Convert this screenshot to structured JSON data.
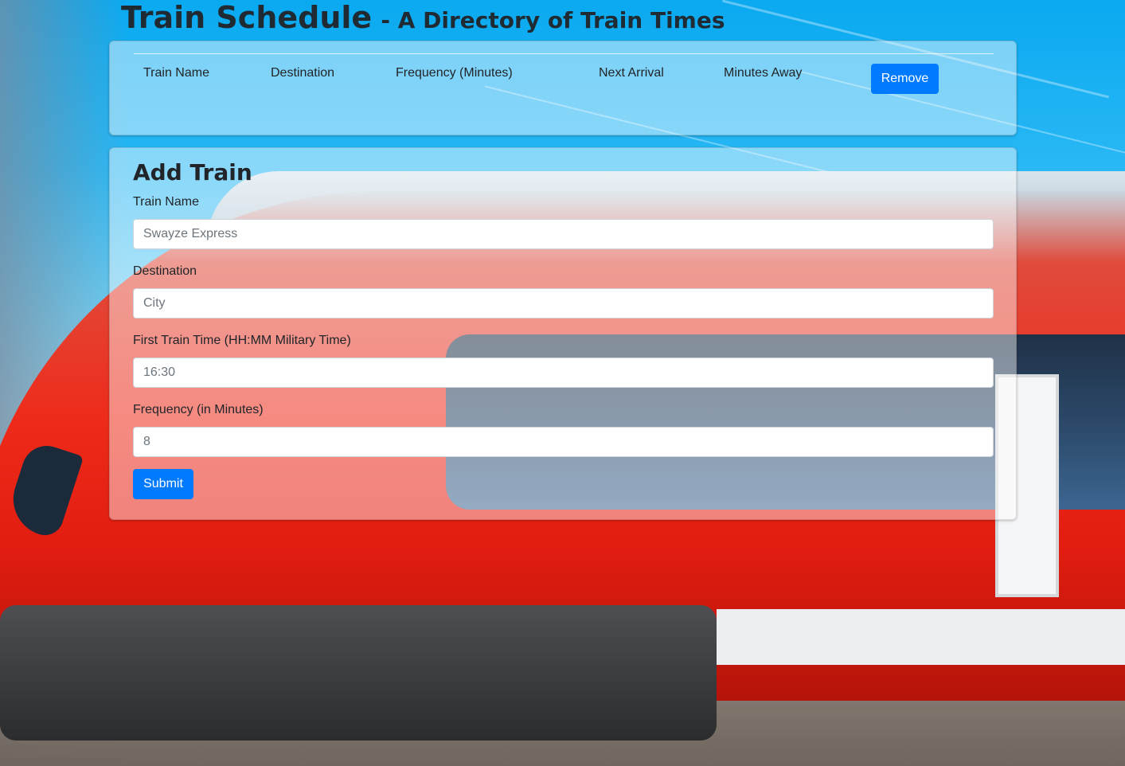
{
  "header": {
    "title": "Train Schedule",
    "subtitle": "- A Directory of Train Times"
  },
  "schedule_table": {
    "columns": [
      "Train Name",
      "Destination",
      "Frequency (Minutes)",
      "Next Arrival",
      "Minutes Away"
    ],
    "remove_label": "Remove",
    "rows": []
  },
  "add_train_form": {
    "title": "Add Train",
    "fields": [
      {
        "label": "Train Name",
        "placeholder": "Swayze Express"
      },
      {
        "label": "Destination",
        "placeholder": "City"
      },
      {
        "label": "First Train Time (HH:MM Military Time)",
        "placeholder": "16:30"
      },
      {
        "label": "Frequency (in Minutes)",
        "placeholder": "8"
      }
    ],
    "submit_label": "Submit"
  },
  "colors": {
    "primary": "#007bff",
    "sky": "#0aa9f0",
    "train_red": "#ee2b1a"
  }
}
